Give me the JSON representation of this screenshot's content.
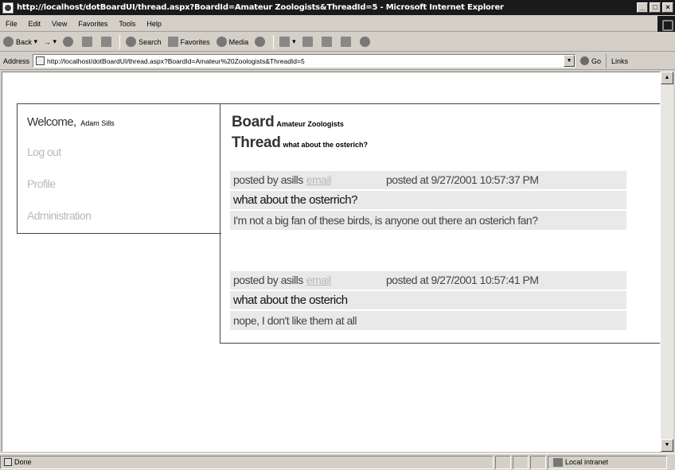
{
  "window": {
    "title": "http://localhost/dotBoardUI/thread.aspx?BoardId=Amateur Zoologists&ThreadId=5 - Microsoft Internet Explorer",
    "controls": [
      "_",
      "□",
      "×"
    ]
  },
  "menu": [
    "File",
    "Edit",
    "View",
    "Favorites",
    "Tools",
    "Help"
  ],
  "toolbar": {
    "back": "Back",
    "forward": "→",
    "search": "Search",
    "favorites": "Favorites",
    "media": "Media"
  },
  "address": {
    "label": "Address",
    "value": "http://localhost/dotBoardUI/thread.aspx?BoardId=Amateur%20Zoologists&ThreadId=5",
    "go": "Go",
    "links": "Links"
  },
  "nav": {
    "welcome": "Welcome,",
    "user": "Adam Sills",
    "logout": "Log out",
    "profile": "Profile",
    "admin": "Administration"
  },
  "thread": {
    "board_label": "Board",
    "board_name": "Amateur Zoologists",
    "thread_label": "Thread",
    "thread_name": "what about the osterich?",
    "posts": [
      {
        "posted_by": "posted by asills",
        "email": "email",
        "posted_at": "posted at 9/27/2001 10:57:37 PM",
        "subject": "what about the osterrich?",
        "body": "I'm not a big fan of these birds, is anyone out there an osterich fan?"
      },
      {
        "posted_by": "posted by asills",
        "email": "email",
        "posted_at": "posted at 9/27/2001 10:57:41 PM",
        "subject": "what about the osterich",
        "body": "nope, I don't like them at all"
      }
    ]
  },
  "status": {
    "text": "Done",
    "zone": "Local intranet"
  }
}
